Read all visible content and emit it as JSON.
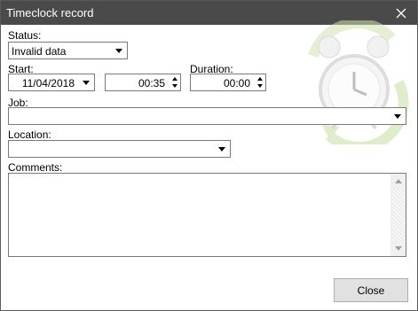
{
  "window": {
    "title": "Timeclock record",
    "titlebar_color": "#4a4a4a",
    "close_icon": "close-icon"
  },
  "form": {
    "status": {
      "label": "Status:",
      "value": "Invalid data"
    },
    "start": {
      "label": "Start:",
      "date": "11/04/2018",
      "time": "00:35"
    },
    "duration": {
      "label": "Duration:",
      "value": "00:00"
    },
    "job": {
      "label": "Job:",
      "value": ""
    },
    "location": {
      "label": "Location:",
      "value": ""
    },
    "comments": {
      "label": "Comments:",
      "value": ""
    }
  },
  "buttons": {
    "close_label": "Close"
  },
  "decor": {
    "icon": "alarm-clock-icon",
    "arrow_color": "#b5d68a"
  }
}
